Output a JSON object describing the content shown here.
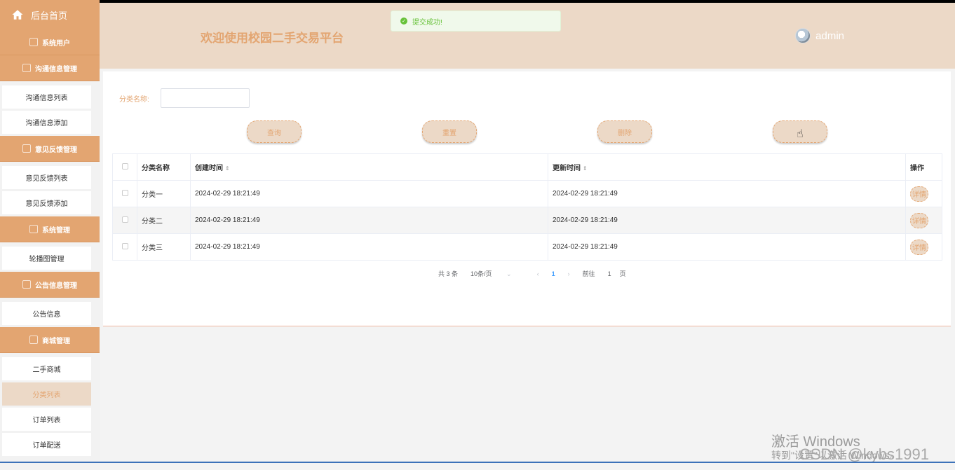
{
  "sidebar": {
    "home": "后台首页",
    "groups": [
      {
        "label": "系统用户",
        "items": []
      },
      {
        "label": "沟通信息管理",
        "items": [
          "沟通信息列表",
          "沟通信息添加"
        ]
      },
      {
        "label": "意见反馈管理",
        "items": [
          "意见反馈列表",
          "意见反馈添加"
        ]
      },
      {
        "label": "系统管理",
        "items": [
          "轮播图管理"
        ]
      },
      {
        "label": "公告信息管理",
        "items": [
          "公告信息"
        ]
      },
      {
        "label": "商城管理",
        "items": [
          "二手商城",
          "分类列表",
          "订单列表",
          "订单配送"
        ]
      }
    ]
  },
  "header": {
    "title": "欢迎使用校园二手交易平台",
    "user": "admin"
  },
  "toast": "提交成功!",
  "search": {
    "label": "分类名称:",
    "value": ""
  },
  "buttons": {
    "query": "查询",
    "reset": "重置",
    "delete": "删除",
    "add": "添加"
  },
  "table": {
    "headers": [
      "分类名称",
      "创建时间",
      "更新时间",
      "操作"
    ],
    "rows": [
      {
        "name": "分类一",
        "created": "2024-02-29 18:21:49",
        "updated": "2024-02-29 18:21:49",
        "action": "详情"
      },
      {
        "name": "分类二",
        "created": "2024-02-29 18:21:49",
        "updated": "2024-02-29 18:21:49",
        "action": "详情"
      },
      {
        "name": "分类三",
        "created": "2024-02-29 18:21:49",
        "updated": "2024-02-29 18:21:49",
        "action": "详情"
      }
    ]
  },
  "pager": {
    "total": "共 3 条",
    "size": "10条/页",
    "current": "1",
    "goto": "前往",
    "goto_page": "1",
    "page_unit": "页"
  },
  "watermark": {
    "line1": "激活 Windows",
    "line2": "转到\"设置\"以激活 Windows。",
    "csdn": "CSDN @kybs1991"
  },
  "colors": {
    "accent": "#e3a571",
    "header_bg": "#ecd9c7"
  }
}
